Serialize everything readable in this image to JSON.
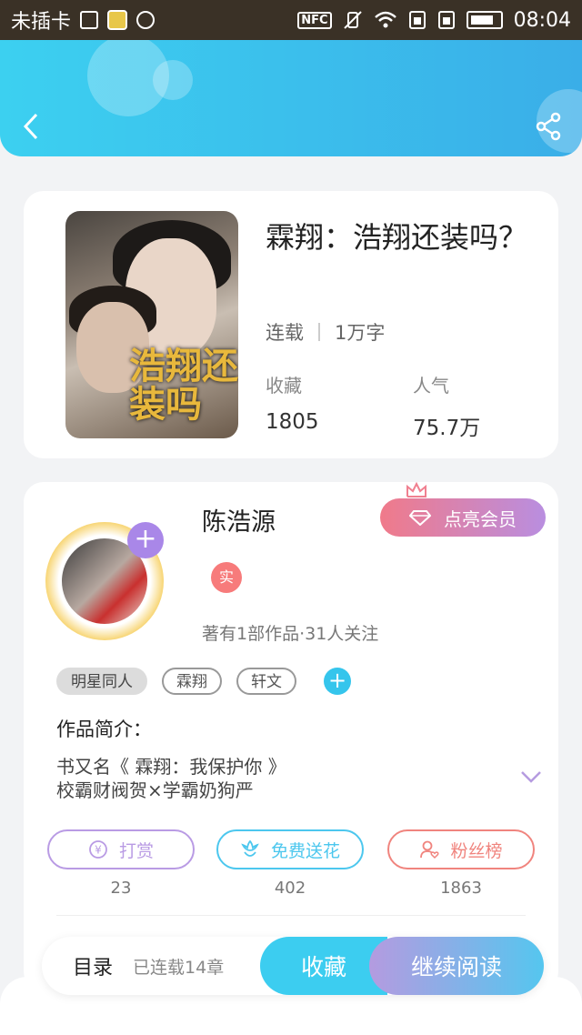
{
  "status_bar": {
    "carrier": "未插卡",
    "nfc": "NFC",
    "time": "08:04"
  },
  "book": {
    "title": "霖翔：浩翔还装吗？",
    "status": "连载",
    "word_count": "1万字",
    "favorites_label": "收藏",
    "favorites_value": "1805",
    "popularity_label": "人气",
    "popularity_value": "75.7万",
    "cover_text": "浩翔还装吗"
  },
  "author": {
    "name": "陈浩源",
    "vip_button": "点亮会员",
    "real_badge": "实",
    "stats": "著有1部作品·31人关注",
    "tags": [
      "明星同人",
      "霖翔",
      "轩文"
    ]
  },
  "intro": {
    "heading": "作品简介：",
    "text": "书又名《 霖翔：我保护你 》\n校霸财阀贺×学霸奶狗严"
  },
  "actions": [
    {
      "label": "打赏",
      "count": "23",
      "icon": "yen-icon",
      "color": "#b99be4"
    },
    {
      "label": "免费送花",
      "count": "402",
      "icon": "flower-icon",
      "color": "#4cc7ee"
    },
    {
      "label": "粉丝榜",
      "count": "1863",
      "icon": "fans-icon",
      "color": "#f0847e"
    }
  ],
  "bottom": {
    "catalog": "目录",
    "chapters": "已连载14章",
    "collect": "收藏",
    "read": "继续阅读"
  }
}
